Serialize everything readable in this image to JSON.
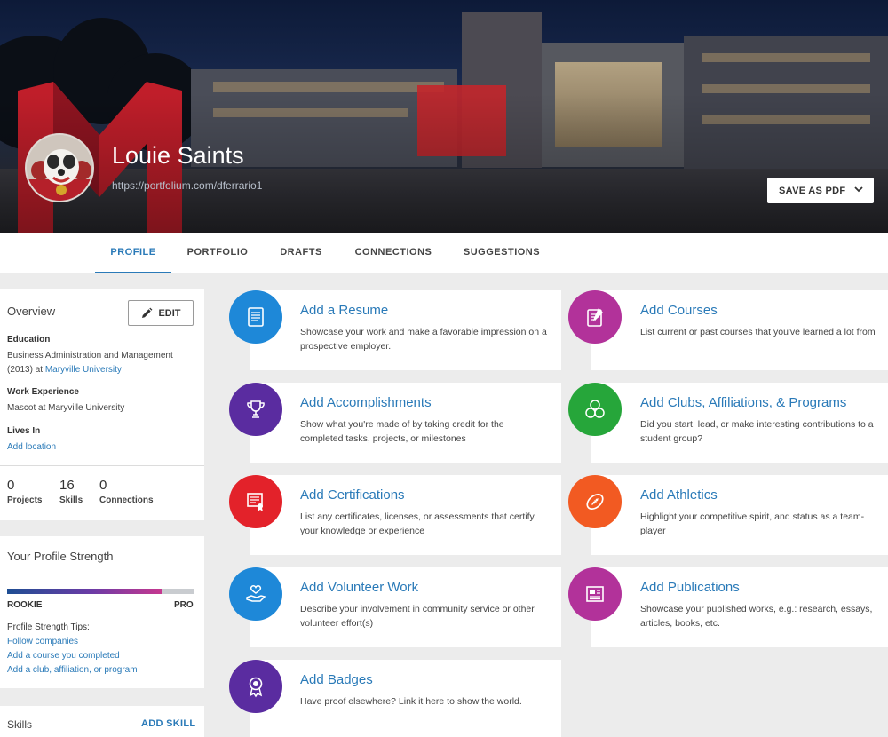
{
  "profile": {
    "name": "Louie Saints",
    "url": "https://portfolium.com/dferrario1",
    "save_pdf_label": "SAVE AS PDF"
  },
  "tabs": [
    {
      "label": "PROFILE",
      "active": true
    },
    {
      "label": "PORTFOLIO",
      "active": false
    },
    {
      "label": "DRAFTS",
      "active": false
    },
    {
      "label": "CONNECTIONS",
      "active": false
    },
    {
      "label": "SUGGESTIONS",
      "active": false
    }
  ],
  "overview": {
    "title": "Overview",
    "edit_label": "EDIT",
    "education_label": "Education",
    "education_line1": "Business Administration and Management",
    "education_line2_prefix": "(2013) at ",
    "education_school": "Maryville University",
    "work_label": "Work Experience",
    "work_text": "Mascot at Maryville University",
    "lives_label": "Lives In",
    "add_location": "Add location",
    "stats": [
      {
        "value": "0",
        "label": "Projects"
      },
      {
        "value": "16",
        "label": "Skills"
      },
      {
        "value": "0",
        "label": "Connections"
      }
    ]
  },
  "strength": {
    "title": "Your Profile Strength",
    "progress": 0.83,
    "min_label": "ROOKIE",
    "max_label": "PRO",
    "tips_title": "Profile Strength Tips:",
    "tips": [
      "Follow companies",
      "Add a course you completed",
      "Add a club, affiliation, or program"
    ]
  },
  "skills": {
    "title": "Skills",
    "add_label": "ADD SKILL"
  },
  "cards": [
    {
      "title": "Add a Resume",
      "desc": "Showcase your work and make a favorable impression on a prospective employer.",
      "icon": "resume-icon",
      "color": "#1e88d8"
    },
    {
      "title": "Add Courses",
      "desc": "List current or past courses that you've learned a lot from",
      "icon": "courses-icon",
      "color": "#b2329a"
    },
    {
      "title": "Add Accomplishments",
      "desc": "Show what you're made of by taking credit for the completed tasks, projects, or milestones",
      "icon": "trophy-icon",
      "color": "#5a2ca0"
    },
    {
      "title": "Add Clubs, Affiliations, & Programs",
      "desc": "Did you start, lead, or make interesting contributions to a student group?",
      "icon": "clubs-icon",
      "color": "#26a63a"
    },
    {
      "title": "Add Certifications",
      "desc": "List any certificates, licenses, or assessments that certify your knowledge or experience",
      "icon": "certificate-icon",
      "color": "#e3222a"
    },
    {
      "title": "Add Athletics",
      "desc": "Highlight your competitive spirit, and status as a team-player",
      "icon": "football-icon",
      "color": "#f25a22"
    },
    {
      "title": "Add Volunteer Work",
      "desc": "Describe your involvement in community service or other volunteer effort(s)",
      "icon": "volunteer-icon",
      "color": "#1e88d8"
    },
    {
      "title": "Add Publications",
      "desc": "Showcase your published works, e.g.: research, essays, articles, books, etc.",
      "icon": "publication-icon",
      "color": "#b2329a"
    },
    {
      "title": "Add Badges",
      "desc": "Have proof elsewhere? Link it here to show the world.",
      "icon": "badge-icon",
      "color": "#5a2ca0"
    }
  ]
}
